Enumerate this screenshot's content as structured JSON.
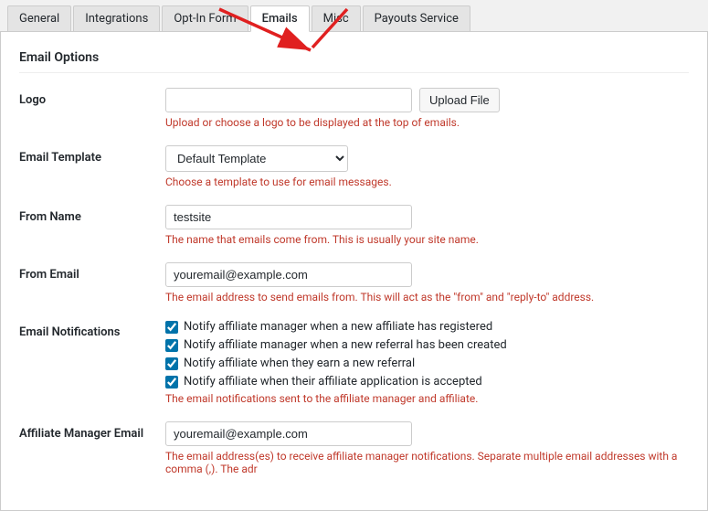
{
  "tabs": [
    {
      "id": "general",
      "label": "General",
      "active": false
    },
    {
      "id": "integrations",
      "label": "Integrations",
      "active": false
    },
    {
      "id": "opt-in-form",
      "label": "Opt-In Form",
      "active": false
    },
    {
      "id": "emails",
      "label": "Emails",
      "active": true
    },
    {
      "id": "misc",
      "label": "Misc",
      "active": false
    },
    {
      "id": "payouts-service",
      "label": "Payouts Service",
      "active": false
    }
  ],
  "section": {
    "title": "Email Options"
  },
  "fields": {
    "logo": {
      "label": "Logo",
      "placeholder": "",
      "upload_btn": "Upload File",
      "help": "Upload or choose a logo to be displayed at the top of emails."
    },
    "email_template": {
      "label": "Email Template",
      "selected": "Default Template",
      "options": [
        "Default Template"
      ],
      "help": "Choose a template to use for email messages."
    },
    "from_name": {
      "label": "From Name",
      "value": "testsite",
      "help": "The name that emails come from. This is usually your site name."
    },
    "from_email": {
      "label": "From Email",
      "value": "youremail@example.com",
      "help": "The email address to send emails from. This will act as the \"from\" and \"reply-to\" address."
    },
    "email_notifications": {
      "label": "Email Notifications",
      "items": [
        {
          "checked": true,
          "text": "Notify affiliate manager when a new affiliate has registered"
        },
        {
          "checked": true,
          "text": "Notify affiliate manager when a new referral has been created"
        },
        {
          "checked": true,
          "text": "Notify affiliate when they earn a new referral"
        },
        {
          "checked": true,
          "text": "Notify affiliate when their affiliate application is accepted"
        }
      ],
      "help": "The email notifications sent to the affiliate manager and affiliate."
    },
    "affiliate_manager_email": {
      "label": "Affiliate Manager Email",
      "value": "youremail@example.com",
      "help": "The email address(es) to receive affiliate manager notifications. Separate multiple email addresses with a comma (,). The adr"
    }
  }
}
